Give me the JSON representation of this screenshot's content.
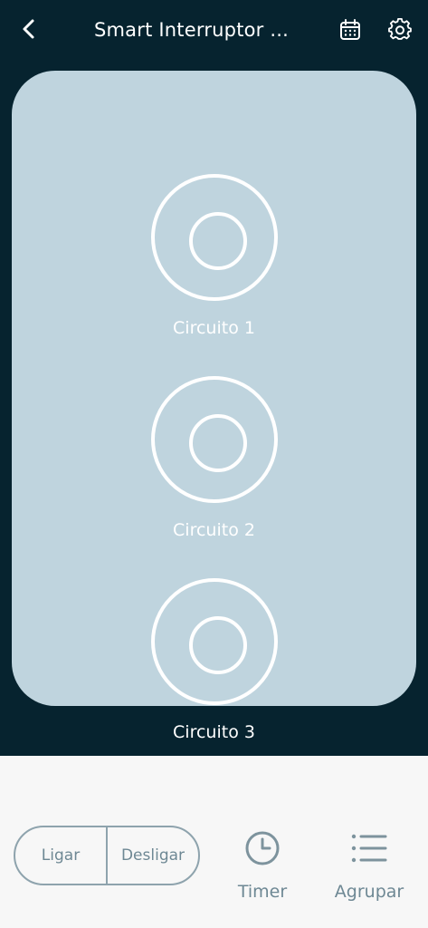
{
  "header": {
    "title": "Smart Interruptor ..."
  },
  "circuits": [
    {
      "label": "Circuito 1"
    },
    {
      "label": "Circuito 2"
    },
    {
      "label": "Circuito 3"
    }
  ],
  "bottom": {
    "on_label": "Ligar",
    "off_label": "Desligar",
    "timer_label": "Timer",
    "group_label": "Agrupar"
  },
  "colors": {
    "header_bg": "#06232f",
    "panel_bg": "#bfd4de",
    "bottom_bg": "#f7f7f7",
    "muted_text": "#6e8894"
  },
  "icons": [
    "back-arrow-icon",
    "calendar-icon",
    "gear-icon",
    "power-button-icon",
    "clock-icon",
    "list-icon"
  ]
}
